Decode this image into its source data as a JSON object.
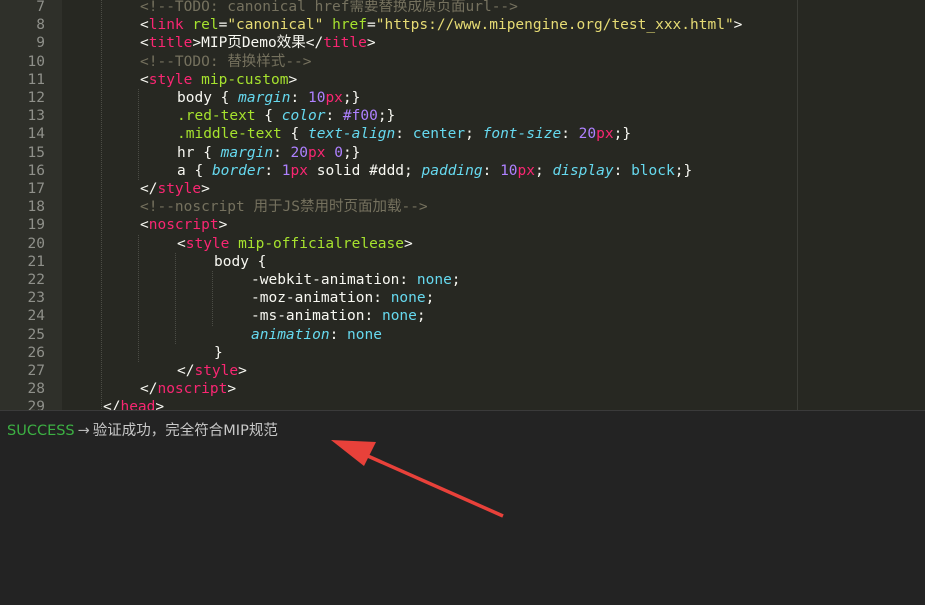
{
  "editor": {
    "lines": [
      {
        "n": "7",
        "indent": 2,
        "tokens": [
          {
            "t": "<!--TODO: canonical href需要替换成原页面url-->",
            "c": "cm"
          }
        ]
      },
      {
        "n": "8",
        "indent": 2,
        "tokens": [
          {
            "t": "<",
            "c": "pl"
          },
          {
            "t": "link",
            "c": "tag"
          },
          {
            "t": " ",
            "c": "pl"
          },
          {
            "t": "rel",
            "c": "attr"
          },
          {
            "t": "=",
            "c": "pl"
          },
          {
            "t": "\"canonical\"",
            "c": "str"
          },
          {
            "t": " ",
            "c": "pl"
          },
          {
            "t": "href",
            "c": "attr"
          },
          {
            "t": "=",
            "c": "pl"
          },
          {
            "t": "\"https://www.mipengine.org/test_xxx.html\"",
            "c": "str"
          },
          {
            "t": ">",
            "c": "pl"
          }
        ]
      },
      {
        "n": "9",
        "indent": 2,
        "tokens": [
          {
            "t": "<",
            "c": "pl"
          },
          {
            "t": "title",
            "c": "tag"
          },
          {
            "t": ">",
            "c": "pl"
          },
          {
            "t": "MIP页Demo效果",
            "c": "pl"
          },
          {
            "t": "</",
            "c": "pl"
          },
          {
            "t": "title",
            "c": "tag"
          },
          {
            "t": ">",
            "c": "pl"
          }
        ]
      },
      {
        "n": "10",
        "indent": 2,
        "tokens": [
          {
            "t": "<!--TODO: 替换样式-->",
            "c": "cm"
          }
        ]
      },
      {
        "n": "11",
        "indent": 2,
        "tokens": [
          {
            "t": "<",
            "c": "pl"
          },
          {
            "t": "style",
            "c": "tag"
          },
          {
            "t": " ",
            "c": "pl"
          },
          {
            "t": "mip-custom",
            "c": "attr"
          },
          {
            "t": ">",
            "c": "pl"
          }
        ]
      },
      {
        "n": "12",
        "indent": 3,
        "tokens": [
          {
            "t": "body",
            "c": "sel"
          },
          {
            "t": " { ",
            "c": "pl"
          },
          {
            "t": "margin",
            "c": "prop"
          },
          {
            "t": ": ",
            "c": "pl"
          },
          {
            "t": "10",
            "c": "num"
          },
          {
            "t": "px",
            "c": "unit"
          },
          {
            "t": ";}",
            "c": "pl"
          }
        ]
      },
      {
        "n": "13",
        "indent": 3,
        "tokens": [
          {
            "t": ".red-text",
            "c": "cls"
          },
          {
            "t": " { ",
            "c": "pl"
          },
          {
            "t": "color",
            "c": "prop"
          },
          {
            "t": ": ",
            "c": "pl"
          },
          {
            "t": "#f00",
            "c": "num"
          },
          {
            "t": ";}",
            "c": "pl"
          }
        ]
      },
      {
        "n": "14",
        "indent": 3,
        "tokens": [
          {
            "t": ".middle-text",
            "c": "cls"
          },
          {
            "t": " { ",
            "c": "pl"
          },
          {
            "t": "text-align",
            "c": "prop"
          },
          {
            "t": ": ",
            "c": "pl"
          },
          {
            "t": "center",
            "c": "kw"
          },
          {
            "t": "; ",
            "c": "pl"
          },
          {
            "t": "font-size",
            "c": "prop"
          },
          {
            "t": ": ",
            "c": "pl"
          },
          {
            "t": "20",
            "c": "num"
          },
          {
            "t": "px",
            "c": "unit"
          },
          {
            "t": ";}",
            "c": "pl"
          }
        ]
      },
      {
        "n": "15",
        "indent": 3,
        "tokens": [
          {
            "t": "hr",
            "c": "sel"
          },
          {
            "t": " { ",
            "c": "pl"
          },
          {
            "t": "margin",
            "c": "prop"
          },
          {
            "t": ": ",
            "c": "pl"
          },
          {
            "t": "20",
            "c": "num"
          },
          {
            "t": "px",
            "c": "unit"
          },
          {
            "t": " ",
            "c": "pl"
          },
          {
            "t": "0",
            "c": "num"
          },
          {
            "t": ";}",
            "c": "pl"
          }
        ]
      },
      {
        "n": "16",
        "indent": 3,
        "tokens": [
          {
            "t": "a",
            "c": "sel"
          },
          {
            "t": " { ",
            "c": "pl"
          },
          {
            "t": "border",
            "c": "prop"
          },
          {
            "t": ": ",
            "c": "pl"
          },
          {
            "t": "1",
            "c": "num"
          },
          {
            "t": "px",
            "c": "unit"
          },
          {
            "t": " solid ",
            "c": "pl"
          },
          {
            "t": "#ddd",
            "c": "pl"
          },
          {
            "t": "; ",
            "c": "pl"
          },
          {
            "t": "padding",
            "c": "prop"
          },
          {
            "t": ": ",
            "c": "pl"
          },
          {
            "t": "10",
            "c": "num"
          },
          {
            "t": "px",
            "c": "unit"
          },
          {
            "t": "; ",
            "c": "pl"
          },
          {
            "t": "display",
            "c": "prop"
          },
          {
            "t": ": ",
            "c": "pl"
          },
          {
            "t": "block",
            "c": "kw"
          },
          {
            "t": ";}",
            "c": "pl"
          }
        ]
      },
      {
        "n": "17",
        "indent": 2,
        "tokens": [
          {
            "t": "</",
            "c": "pl"
          },
          {
            "t": "style",
            "c": "tag"
          },
          {
            "t": ">",
            "c": "pl"
          }
        ]
      },
      {
        "n": "18",
        "indent": 2,
        "tokens": [
          {
            "t": "<!--noscript 用于JS禁用时页面加载-->",
            "c": "cm"
          }
        ]
      },
      {
        "n": "19",
        "indent": 2,
        "tokens": [
          {
            "t": "<",
            "c": "pl"
          },
          {
            "t": "noscript",
            "c": "tag"
          },
          {
            "t": ">",
            "c": "pl"
          }
        ]
      },
      {
        "n": "20",
        "indent": 3,
        "tokens": [
          {
            "t": "<",
            "c": "pl"
          },
          {
            "t": "style",
            "c": "tag"
          },
          {
            "t": " ",
            "c": "pl"
          },
          {
            "t": "mip-officialrelease",
            "c": "attr"
          },
          {
            "t": ">",
            "c": "pl"
          }
        ]
      },
      {
        "n": "21",
        "indent": 4,
        "tokens": [
          {
            "t": "body",
            "c": "sel"
          },
          {
            "t": " {",
            "c": "pl"
          }
        ]
      },
      {
        "n": "22",
        "indent": 5,
        "tokens": [
          {
            "t": "-webkit-animation",
            "c": "pl"
          },
          {
            "t": ": ",
            "c": "pl"
          },
          {
            "t": "none",
            "c": "kw"
          },
          {
            "t": ";",
            "c": "pl"
          }
        ]
      },
      {
        "n": "23",
        "indent": 5,
        "tokens": [
          {
            "t": "-moz-animation",
            "c": "pl"
          },
          {
            "t": ": ",
            "c": "pl"
          },
          {
            "t": "none",
            "c": "kw"
          },
          {
            "t": ";",
            "c": "pl"
          }
        ]
      },
      {
        "n": "24",
        "indent": 5,
        "tokens": [
          {
            "t": "-ms-animation",
            "c": "pl"
          },
          {
            "t": ": ",
            "c": "pl"
          },
          {
            "t": "none",
            "c": "kw"
          },
          {
            "t": ";",
            "c": "pl"
          }
        ]
      },
      {
        "n": "25",
        "indent": 5,
        "tokens": [
          {
            "t": "animation",
            "c": "prop"
          },
          {
            "t": ": ",
            "c": "pl"
          },
          {
            "t": "none",
            "c": "kw"
          }
        ]
      },
      {
        "n": "26",
        "indent": 4,
        "tokens": [
          {
            "t": "}",
            "c": "pl"
          }
        ]
      },
      {
        "n": "27",
        "indent": 3,
        "tokens": [
          {
            "t": "</",
            "c": "pl"
          },
          {
            "t": "style",
            "c": "tag"
          },
          {
            "t": ">",
            "c": "pl"
          }
        ]
      },
      {
        "n": "28",
        "indent": 2,
        "tokens": [
          {
            "t": "</",
            "c": "pl"
          },
          {
            "t": "noscript",
            "c": "tag"
          },
          {
            "t": ">",
            "c": "pl"
          }
        ]
      },
      {
        "n": "29",
        "indent": 1,
        "tokens": [
          {
            "t": "</",
            "c": "pl"
          },
          {
            "t": "head",
            "c": "tag"
          },
          {
            "t": ">",
            "c": "pl"
          }
        ]
      }
    ]
  },
  "console": {
    "status": "SUCCESS",
    "separator": "→",
    "message": "验证成功，完全符合MIP规范"
  },
  "colors": {
    "editor_bg": "#272822",
    "console_bg": "#232323",
    "success": "#3cb043",
    "annotation_arrow": "#e8413a"
  }
}
